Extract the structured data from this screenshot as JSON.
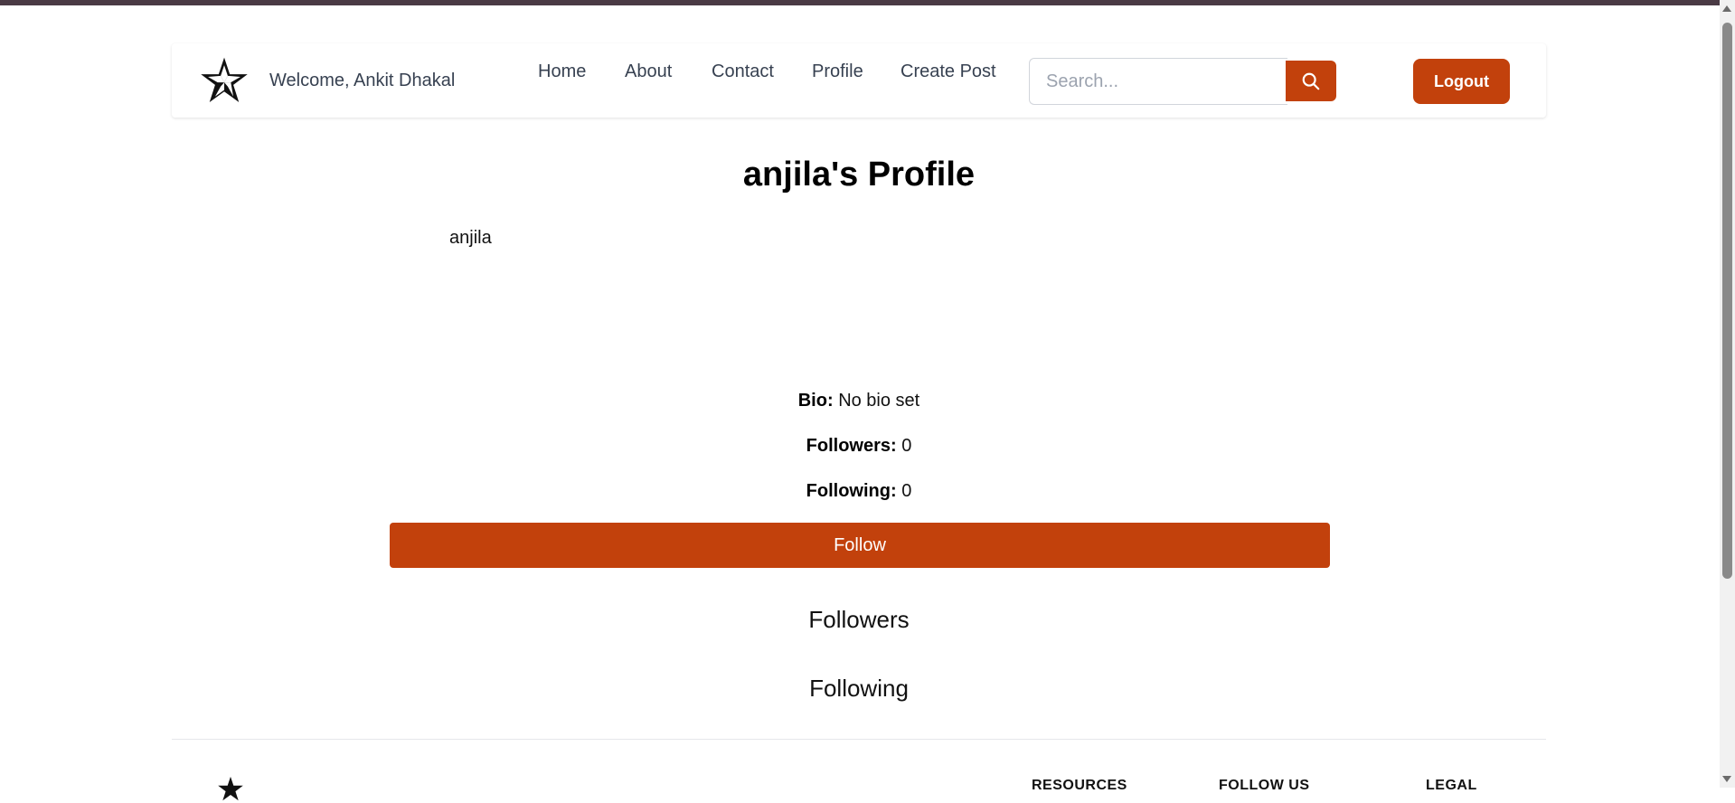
{
  "colors": {
    "accent": "#c2410c",
    "top_strip": "#4a3a44"
  },
  "header": {
    "logo_icon": "star-icon",
    "welcome_text": "Welcome, Ankit Dhakal",
    "nav": [
      {
        "label": "Home"
      },
      {
        "label": "About"
      },
      {
        "label": "Contact"
      },
      {
        "label": "Profile"
      },
      {
        "label": "Create Post"
      }
    ],
    "search": {
      "placeholder": "Search...",
      "value": "",
      "icon": "search-icon"
    },
    "logout_label": "Logout"
  },
  "profile": {
    "title": "anjila's Profile",
    "username": "anjila",
    "bio_label": "Bio:",
    "bio_value": "No bio set",
    "followers_label": "Followers:",
    "followers_value": "0",
    "following_label": "Following:",
    "following_value": "0",
    "follow_button": "Follow",
    "followers_heading": "Followers",
    "following_heading": "Following"
  },
  "footer": {
    "logo_icon": "star-icon",
    "headings": [
      "RESOURCES",
      "FOLLOW US",
      "LEGAL"
    ]
  }
}
